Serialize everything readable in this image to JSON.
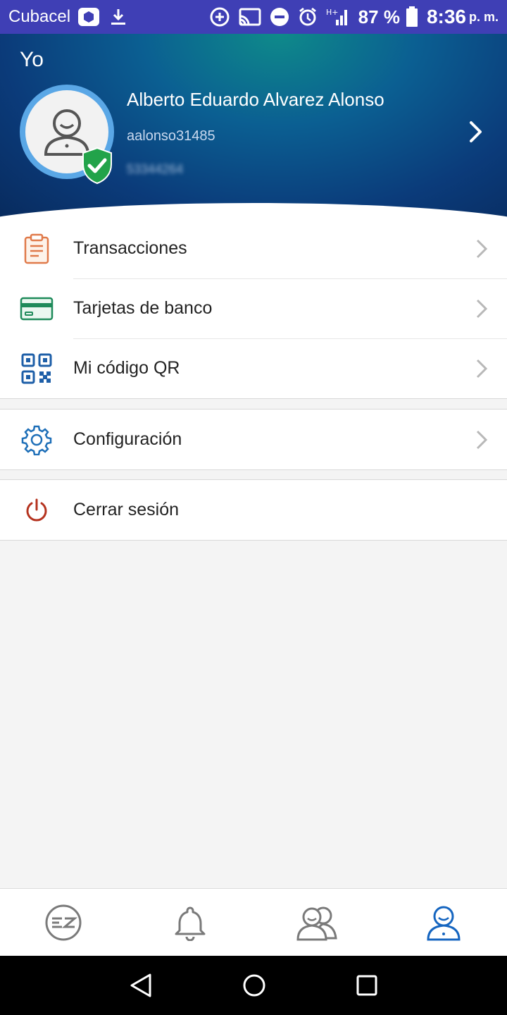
{
  "status_bar": {
    "carrier": "Cubacel",
    "battery": "87 %",
    "time": "8:36",
    "ampm": "p. m."
  },
  "header": {
    "title": "Yo",
    "name": "Alberto Eduardo Alvarez Alonso",
    "username": "aalonso31485",
    "phone": "53344264"
  },
  "menu": {
    "transactions": "Transacciones",
    "bank_cards": "Tarjetas de banco",
    "qr_code": "Mi código QR",
    "settings": "Configuración",
    "logout": "Cerrar sesión"
  },
  "colors": {
    "status_bar": "#3f3fb5",
    "accent": "#1565c0",
    "verified_green": "#22a34a",
    "logout_red": "#b5331f"
  },
  "bottom_nav": {
    "tabs": [
      "home-icon",
      "bell-icon",
      "contacts-icon",
      "profile-icon"
    ],
    "active": "profile-icon"
  }
}
